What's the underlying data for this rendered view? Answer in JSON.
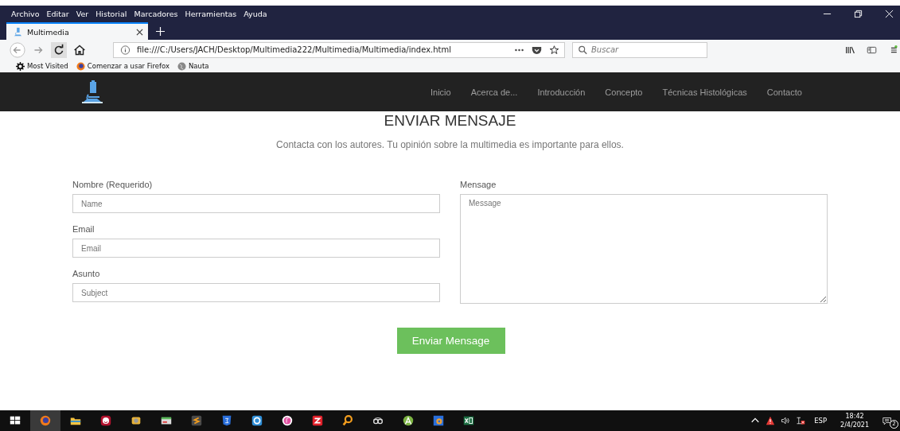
{
  "menu_bar": {
    "items": [
      "Archivo",
      "Editar",
      "Ver",
      "Historial",
      "Marcadores",
      "Herramientas",
      "Ayuda"
    ]
  },
  "tabs": [
    {
      "label": "Multimedia",
      "selected": true
    }
  ],
  "toolbar": {
    "url": "file:///C:/Users/JACH/Desktop/Multimedia222/Multimedia/Multimedia/index.html",
    "search": {
      "placeholder": "Buscar"
    }
  },
  "bookmarks": [
    "Most Visited",
    "Comenzar a usar Firefox",
    "Nauta"
  ],
  "site_nav": {
    "items": [
      "Inicio",
      "Acerca de...",
      "Introducción",
      "Concepto",
      "Técnicas Histológicas",
      "Contacto"
    ]
  },
  "contact": {
    "title": "ENVIAR MENSAJE",
    "subtitle": "Contacta con los autores. Tu opinión sobre la multimedia es importante para ellos.",
    "fields": [
      {
        "label": "Nombre (Requerido)",
        "placeholder": "Name"
      },
      {
        "label": "Email",
        "placeholder": "Email"
      },
      {
        "label": "Asunto",
        "placeholder": "Subject"
      }
    ],
    "message": {
      "label": "Mensage",
      "placeholder": "Message"
    },
    "button": "Enviar Mensage"
  },
  "taskbar": {
    "language": "ESP",
    "time": "18:42",
    "date": "2/4/2021",
    "notifications": "2"
  }
}
